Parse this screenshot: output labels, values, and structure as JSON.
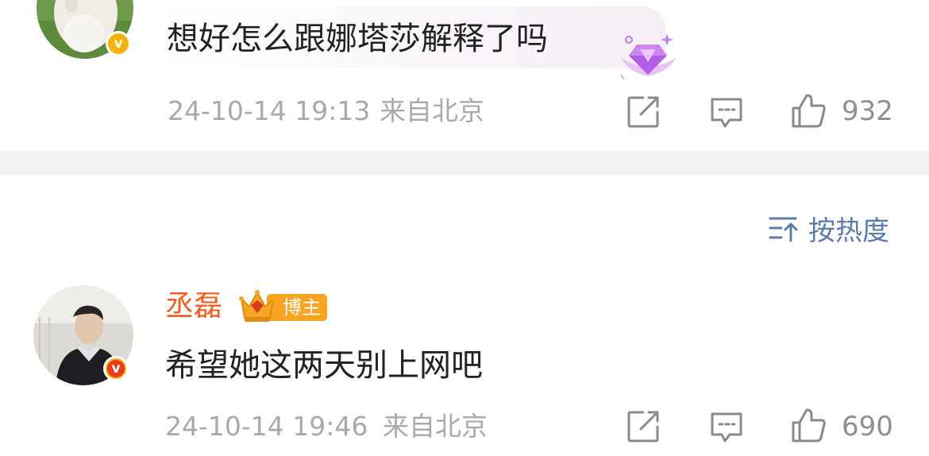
{
  "comments": [
    {
      "text": "想好怎么跟娜塔莎解释了吗",
      "timestamp": "24-10-14 19:13",
      "location": "来自北京",
      "likes": "932",
      "verified_badge": "v",
      "badge_color": "#f5b20a",
      "icons": [
        "share-icon",
        "comment-icon",
        "like-icon",
        "diamond-fan-badge-icon"
      ]
    },
    {
      "username": "丞磊",
      "host_label": "博主",
      "text": "希望她这两天别上网吧",
      "timestamp": "24-10-14 19:46",
      "location": "来自北京",
      "likes": "690",
      "verified_badge": "v",
      "badge_color": "#e63c1d",
      "icons": [
        "share-icon",
        "comment-icon",
        "like-icon",
        "crown-badge-icon"
      ]
    }
  ],
  "sort": {
    "label": "按热度",
    "icon": "sort-icon"
  },
  "colors": {
    "username": "#f05c21",
    "meta_text": "#a9a9a9",
    "sort_link": "#5b7ba8",
    "host_badge": "#f7a420",
    "divider": "#f1f1f1"
  }
}
